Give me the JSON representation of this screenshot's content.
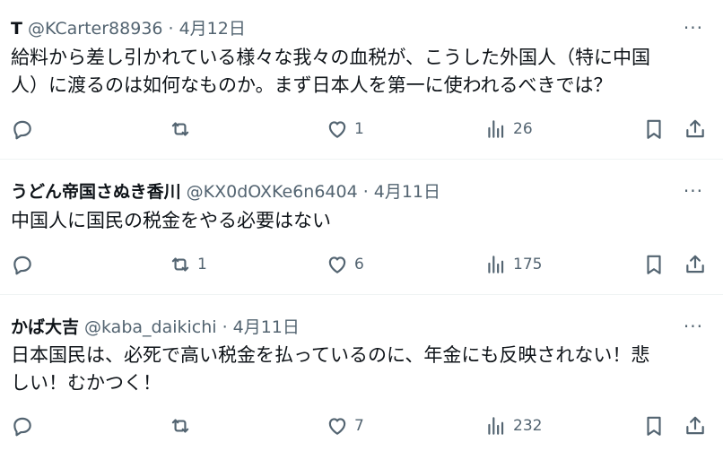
{
  "tweets": [
    {
      "name": "T",
      "handle": "@KCarter88936",
      "separator": "·",
      "date": "4月12日",
      "more": "···",
      "lines": [
        "給料から差し引かれている様々な我々の血税が、こうした外国人（特に中国",
        "人）に渡るのは如何なものか。まず日本人を第一に使われるべきでは？"
      ],
      "replies": "",
      "retweets": "",
      "likes": "1",
      "views": "26"
    },
    {
      "name": "うどん帝国さぬき香川",
      "handle": "@KX0dOXKe6n6404",
      "separator": "·",
      "date": "4月11日",
      "more": "···",
      "lines": [
        "中国人に国民の税金をやる必要はない"
      ],
      "replies": "",
      "retweets": "1",
      "likes": "6",
      "views": "175"
    },
    {
      "name": "かば大吉",
      "handle": "@kaba_daikichi",
      "separator": "·",
      "date": "4月11日",
      "more": "···",
      "lines": [
        "日本国民は、必死で高い税金を払っているのに、年金にも反映されない！悲",
        "しい！むかつく！"
      ],
      "replies": "",
      "retweets": "",
      "likes": "7",
      "views": "232"
    }
  ],
  "icons": {
    "reply": "reply-icon",
    "retweet": "retweet-icon",
    "like": "heart-icon",
    "views": "views-icon",
    "bookmark": "bookmark-icon",
    "share": "share-icon"
  },
  "colors": {
    "text": "#0f1419",
    "secondary": "#536471",
    "divider": "#eff3f4"
  }
}
